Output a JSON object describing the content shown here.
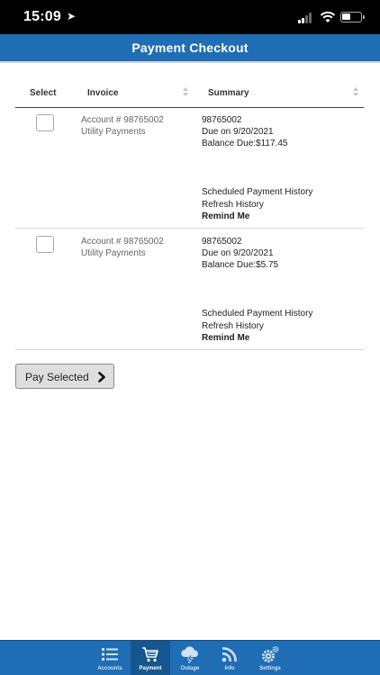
{
  "status_bar": {
    "time": "15:09",
    "location_arrow": "location-arrow-icon"
  },
  "header": {
    "title": "Payment Checkout"
  },
  "table": {
    "columns": {
      "select": "Select",
      "invoice": "Invoice",
      "summary": "Summary"
    },
    "rows": [
      {
        "account_label": "Account # 98765002",
        "account_type": "Utility Payments",
        "summary_id": "98765002",
        "due": "Due on 9/20/2021",
        "balance": "Balance Due:$117.45",
        "link_history": "Scheduled Payment History",
        "link_refresh": "Refresh History",
        "link_remind": "Remind Me"
      },
      {
        "account_label": "Account # 98765002",
        "account_type": "Utility Payments",
        "summary_id": "98765002",
        "due": "Due on 9/20/2021",
        "balance": "Balance Due:$5.75",
        "link_history": "Scheduled Payment History",
        "link_refresh": "Refresh History",
        "link_remind": "Remind Me"
      }
    ]
  },
  "pay_button": {
    "label": "Pay Selected"
  },
  "tab_bar": {
    "active": "Payment",
    "tabs": [
      {
        "label": "Accounts",
        "icon": "list-icon"
      },
      {
        "label": "Payment",
        "icon": "cart-icon"
      },
      {
        "label": "Outage",
        "icon": "cloud-lightning-icon"
      },
      {
        "label": "Info",
        "icon": "rss-icon"
      },
      {
        "label": "Settings",
        "icon": "gears-icon"
      }
    ]
  },
  "colors": {
    "brand": "#1f6db5",
    "active_tab": "#15568f"
  }
}
